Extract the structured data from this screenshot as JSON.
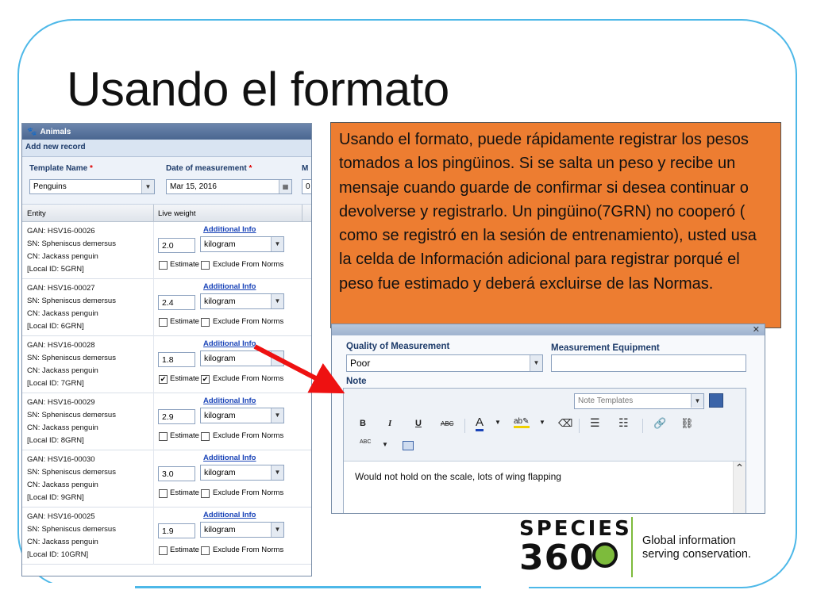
{
  "slide": {
    "title": "Usando el formato",
    "description": "Usando el formato, puede rápidamente registrar los pesos tomados a los pingüinos. Si se salta un peso y recibe un mensaje cuando guarde de confirmar si desea continuar o devolverse y registrarlo. Un pingüino(7GRN) no cooperó ( como se registró en la sesión de entrenamiento), usted usa la celda de Información adicional para registrar porqué el peso fue estimado y deberá excluirse de las Normas."
  },
  "animals_panel": {
    "header": "Animals",
    "add_record": "Add new record",
    "template_label": "Template Name",
    "template_value": "Penguins",
    "date_label": "Date of measurement",
    "date_value": "Mar 15, 2016",
    "third_label": "M",
    "third_value": "0",
    "required_mark": "*",
    "col_entity": "Entity",
    "col_weight": "Live weight",
    "additional_info": "Additional Info",
    "estimate_label": "Estimate",
    "exclude_label": "Exclude From Norms",
    "rows": [
      {
        "gan": "GAN: HSV16-00026",
        "sn": "SN: Spheniscus demersus",
        "cn": "CN: Jackass penguin",
        "local": "[Local ID: 5GRN]",
        "weight": "2.0",
        "unit": "kilogram",
        "estimate": false,
        "exclude": false
      },
      {
        "gan": "GAN: HSV16-00027",
        "sn": "SN: Spheniscus demersus",
        "cn": "CN: Jackass penguin",
        "local": "[Local ID: 6GRN]",
        "weight": "2.4",
        "unit": "kilogram",
        "estimate": false,
        "exclude": false
      },
      {
        "gan": "GAN: HSV16-00028",
        "sn": "SN: Spheniscus demersus",
        "cn": "CN: Jackass penguin",
        "local": "[Local ID: 7GRN]",
        "weight": "1.8",
        "unit": "kilogram",
        "estimate": true,
        "exclude": true
      },
      {
        "gan": "GAN: HSV16-00029",
        "sn": "SN: Spheniscus demersus",
        "cn": "CN: Jackass penguin",
        "local": "[Local ID: 8GRN]",
        "weight": "2.9",
        "unit": "kilogram",
        "estimate": false,
        "exclude": false
      },
      {
        "gan": "GAN: HSV16-00030",
        "sn": "SN: Spheniscus demersus",
        "cn": "CN: Jackass penguin",
        "local": "[Local ID: 9GRN]",
        "weight": "3.0",
        "unit": "kilogram",
        "estimate": false,
        "exclude": false
      },
      {
        "gan": "GAN: HSV16-00025",
        "sn": "SN: Spheniscus demersus",
        "cn": "CN: Jackass penguin",
        "local": "[Local ID: 10GRN]",
        "weight": "1.9",
        "unit": "kilogram",
        "estimate": false,
        "exclude": false
      }
    ]
  },
  "measurement_panel": {
    "quality_label": "Quality of Measurement",
    "quality_value": "Poor",
    "equipment_label": "Measurement Equipment",
    "equipment_value": "",
    "note_label": "Note",
    "note_templates": "Note Templates",
    "note_text": "Would not hold on the scale, lots of wing flapping",
    "toolbar": {
      "bold": "B",
      "italic": "I",
      "underline": "U",
      "strike": "ABC",
      "font_color": "A",
      "spell": "ABC"
    }
  },
  "logo": {
    "word": "SPECIES",
    "number": "360",
    "tagline_1": "Global information",
    "tagline_2": "serving conservation."
  },
  "colors": {
    "accent_orange": "#ed7d31",
    "frame_blue": "#4db8e8",
    "logo_green": "#7dbb3c",
    "link_blue": "#1a44b8"
  }
}
